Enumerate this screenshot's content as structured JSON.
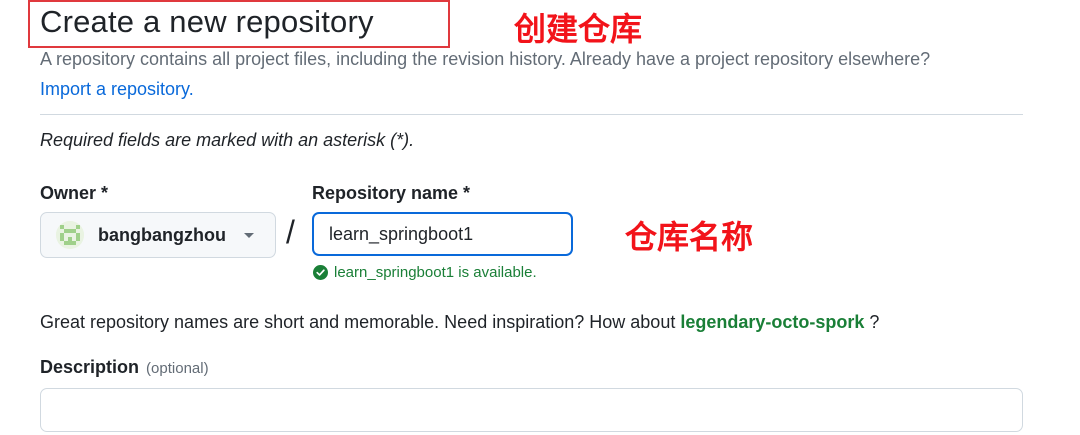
{
  "header": {
    "title": "Create a new repository",
    "annotation": "创建仓库"
  },
  "intro": {
    "description": "A repository contains all project files, including the revision history. Already have a project repository elsewhere?",
    "import_link": "Import a repository."
  },
  "required_note": "Required fields are marked with an asterisk (*).",
  "owner": {
    "label": "Owner *",
    "selected": "bangbangzhou"
  },
  "separator": "/",
  "repository": {
    "label": "Repository name *",
    "value": "learn_springboot1",
    "availability": "learn_springboot1 is available.",
    "annotation": "仓库名称"
  },
  "naming_hint": {
    "prefix": "Great repository names are short and memorable. Need inspiration? How about",
    "suggestion": "legendary-octo-spork",
    "suffix": "?"
  },
  "description_field": {
    "label": "Description",
    "optional": "(optional)",
    "value": ""
  },
  "colors": {
    "accent": "#0969da",
    "success": "#1a7f37",
    "annotation_red": "#f2131a"
  }
}
